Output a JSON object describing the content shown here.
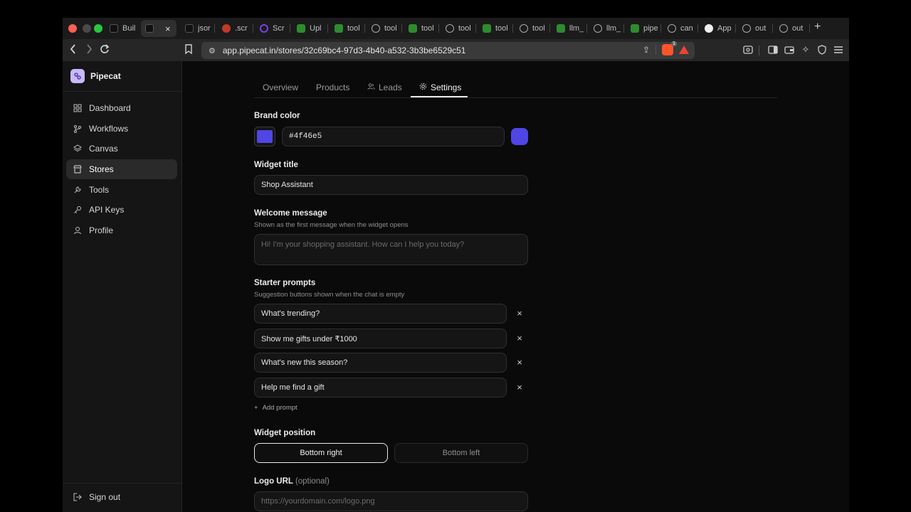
{
  "browser": {
    "tabs": [
      {
        "label": "Buil",
        "icon": "app-icon"
      },
      {
        "label": "",
        "icon": "app-icon",
        "active": true
      },
      {
        "label": "jsor",
        "icon": "app-icon"
      },
      {
        "label": ".scr",
        "icon": "record-icon"
      },
      {
        "label": "Scr",
        "icon": "circle-icon"
      },
      {
        "label": "Upl",
        "icon": "doc-icon"
      },
      {
        "label": "tool",
        "icon": "doc-icon"
      },
      {
        "label": "tool",
        "icon": "globe-icon"
      },
      {
        "label": "tool",
        "icon": "doc-icon"
      },
      {
        "label": "tool",
        "icon": "globe-icon"
      },
      {
        "label": "tool",
        "icon": "doc-icon"
      },
      {
        "label": "tool",
        "icon": "globe-icon"
      },
      {
        "label": "llm_",
        "icon": "doc-icon"
      },
      {
        "label": "llm_",
        "icon": "globe-icon"
      },
      {
        "label": "pipe",
        "icon": "doc-icon"
      },
      {
        "label": "can",
        "icon": "globe-icon"
      },
      {
        "label": "App",
        "icon": "openai-icon"
      },
      {
        "label": "out",
        "icon": "globe-icon"
      },
      {
        "label": "out",
        "icon": "globe-icon"
      }
    ],
    "close_glyph": "×",
    "newtab_glyph": "+",
    "url": "app.pipecat.in/stores/32c69bc4-97d3-4b40-a532-3b3be6529c51",
    "brave_badge": "1"
  },
  "sidebar": {
    "brand": "Pipecat",
    "items": [
      {
        "label": "Dashboard",
        "icon": "grid-icon"
      },
      {
        "label": "Workflows",
        "icon": "branch-icon"
      },
      {
        "label": "Canvas",
        "icon": "layers-icon"
      },
      {
        "label": "Stores",
        "icon": "store-icon",
        "active": true
      },
      {
        "label": "Tools",
        "icon": "wrench-icon"
      },
      {
        "label": "API Keys",
        "icon": "key-icon"
      },
      {
        "label": "Profile",
        "icon": "user-icon"
      }
    ],
    "sign_out": "Sign out"
  },
  "page_tabs": {
    "overview": "Overview",
    "products": "Products",
    "leads": "Leads",
    "settings": "Settings",
    "active": "Settings"
  },
  "settings": {
    "brand_color": {
      "label": "Brand color",
      "value": "#4f46e5",
      "color": "#4f46e5"
    },
    "widget_title": {
      "label": "Widget title",
      "value": "Shop Assistant"
    },
    "welcome_message": {
      "label": "Welcome message",
      "hint": "Shown as the first message when the widget opens",
      "placeholder": "Hi! I'm your shopping assistant. How can I help you today?"
    },
    "starter_prompts": {
      "label": "Starter prompts",
      "hint": "Suggestion buttons shown when the chat is empty",
      "items": [
        "What's trending?",
        "Show me gifts under ₹1000",
        "What's new this season?",
        "Help me find a gift"
      ],
      "add_label": "Add prompt",
      "remove_glyph": "×"
    },
    "widget_position": {
      "label": "Widget position",
      "options": [
        "Bottom right",
        "Bottom left"
      ],
      "selected": "Bottom right"
    },
    "logo_url": {
      "label": "Logo URL",
      "optional": "(optional)",
      "placeholder": "https://yourdomain.com/logo.png"
    }
  }
}
